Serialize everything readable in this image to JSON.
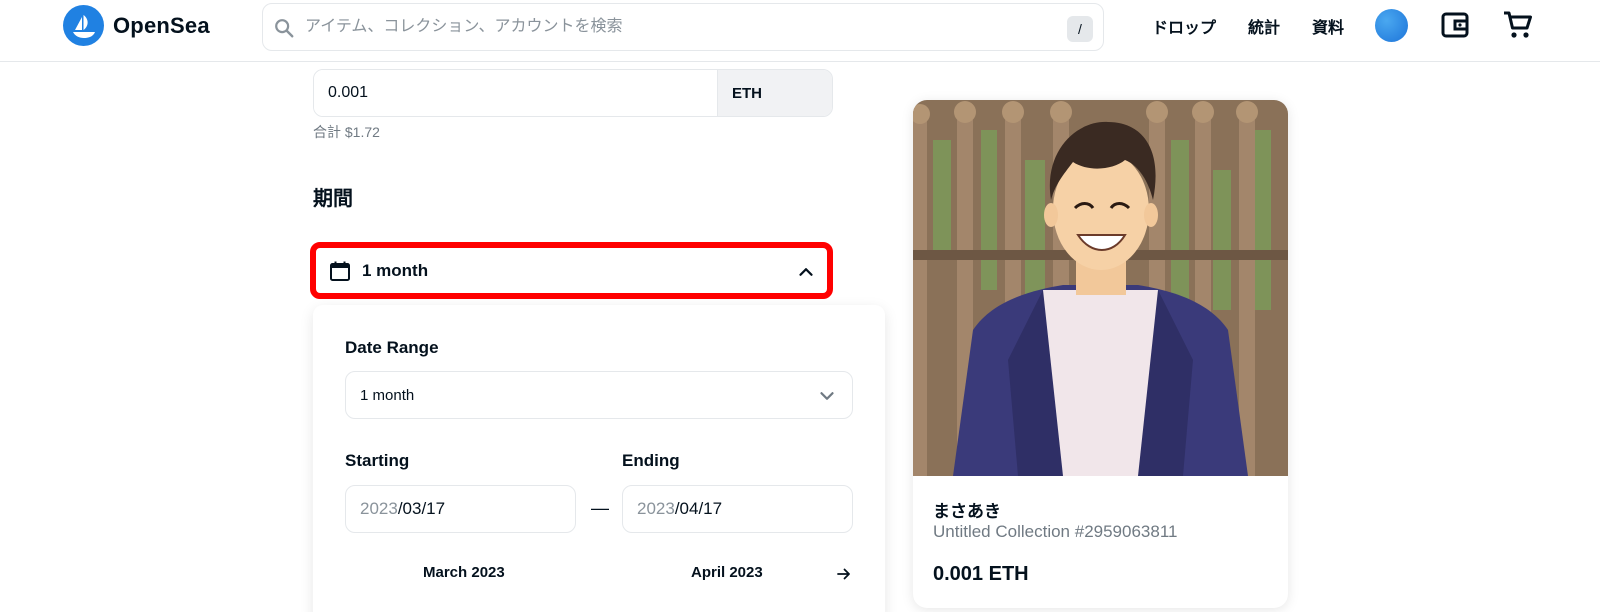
{
  "header": {
    "brand": "OpenSea",
    "search_placeholder": "アイテム、コレクション、アカウントを検索",
    "search_shortcut": "/",
    "nav": [
      "ドロップ",
      "統計",
      "資料"
    ],
    "accent_color": "#2081e2"
  },
  "listing": {
    "price_value": "0.001",
    "currency": "ETH",
    "total": "合計 $1.72",
    "duration_section_title": "期間",
    "duration_value": "1 month",
    "duration_highlight_color": "#ff0000"
  },
  "duration_panel": {
    "date_range_label": "Date Range",
    "date_range_value": "1 month",
    "starting_label": "Starting",
    "starting_year": "2023",
    "starting_rest": "/03/17",
    "ending_label": "Ending",
    "ending_year": "2023",
    "ending_rest": "/04/17",
    "separator": "—",
    "month_left": "March 2023",
    "month_right": "April 2023"
  },
  "card": {
    "owner": "まさあき",
    "collection": "Untitled Collection #2959063811",
    "price": "0.001 ETH",
    "image_subject": "anime-style illustration of a smiling man in a blue jacket in front of a wooden fence"
  },
  "icons": [
    "opensea-logo-icon",
    "search-icon",
    "profile-avatar",
    "wallet-icon",
    "cart-icon",
    "calendar-icon",
    "chevron-up-icon",
    "chevron-down-icon",
    "arrow-right-icon"
  ]
}
